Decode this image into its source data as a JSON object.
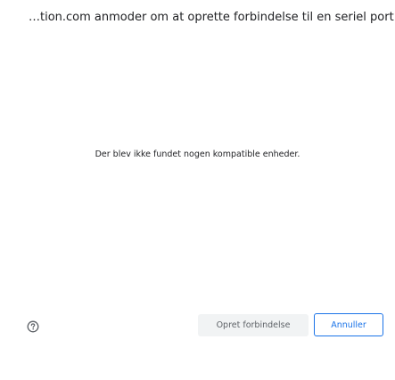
{
  "dialog": {
    "title": "…tion.com anmoder om at oprette forbindelse til en seriel port",
    "message": "Der blev ikke fundet nogen kompatible enheder."
  },
  "footer": {
    "help_icon": "help-circle-icon",
    "connect_label": "Opret forbindelse",
    "cancel_label": "Annuller"
  },
  "colors": {
    "accent": "#1a73e8",
    "disabled_bg": "#f1f3f4",
    "disabled_text": "#5f6368",
    "text": "#202124"
  }
}
